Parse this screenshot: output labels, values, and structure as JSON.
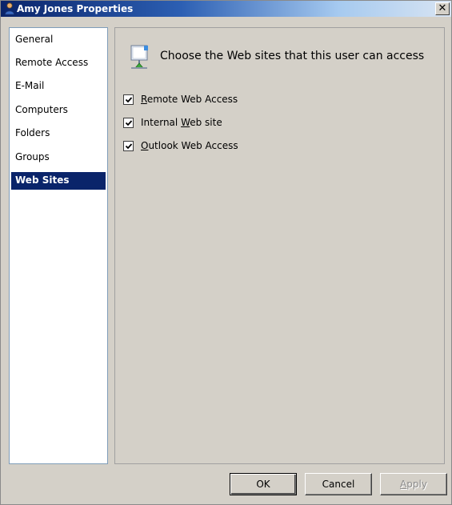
{
  "window": {
    "title": "Amy Jones Properties",
    "close_glyph": "✕"
  },
  "nav": {
    "items": [
      {
        "label": "General"
      },
      {
        "label": "Remote Access"
      },
      {
        "label": "E-Mail"
      },
      {
        "label": "Computers"
      },
      {
        "label": "Folders"
      },
      {
        "label": "Groups"
      },
      {
        "label": "Web Sites"
      }
    ],
    "selected": "Web Sites"
  },
  "content": {
    "header_icon": "web-site-icon",
    "header_text": "Choose the Web sites that this user can access",
    "checkboxes": [
      {
        "label_pre": "",
        "accel": "R",
        "label_post": "emote Web Access",
        "checked": true
      },
      {
        "label_pre": "Internal ",
        "accel": "W",
        "label_post": "eb site",
        "checked": true
      },
      {
        "label_pre": "",
        "accel": "O",
        "label_post": "utlook Web Access",
        "checked": true
      }
    ]
  },
  "buttons": {
    "ok": "OK",
    "cancel": "Cancel",
    "apply_accel": "A",
    "apply_rest": "pply",
    "apply_enabled": false
  },
  "colors": {
    "selection": "#0a246a",
    "titlebar_start": "#0a246a",
    "dialog_face": "#d4d0c8"
  }
}
